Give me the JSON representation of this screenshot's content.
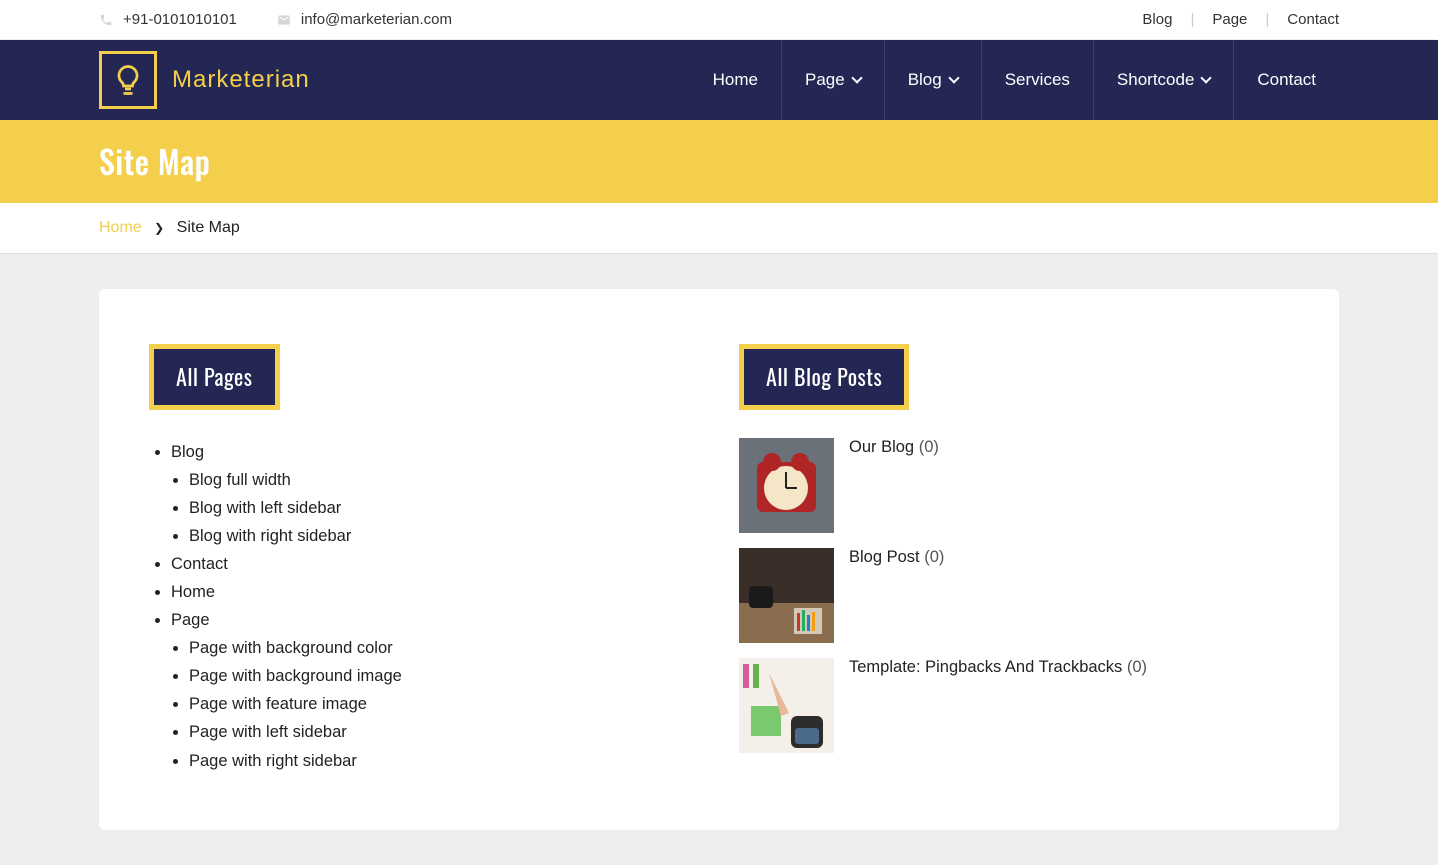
{
  "topbar": {
    "phone": "+91-0101010101",
    "email": "info@marketerian.com",
    "links": [
      "Blog",
      "Page",
      "Contact"
    ]
  },
  "brand": {
    "name": "Marketerian"
  },
  "nav": {
    "items": [
      {
        "label": "Home",
        "dropdown": false
      },
      {
        "label": "Page",
        "dropdown": true
      },
      {
        "label": "Blog",
        "dropdown": true
      },
      {
        "label": "Services",
        "dropdown": false
      },
      {
        "label": "Shortcode",
        "dropdown": true
      },
      {
        "label": "Contact",
        "dropdown": false
      }
    ]
  },
  "page_title": "Site Map",
  "breadcrumb": {
    "home": "Home",
    "current": "Site Map"
  },
  "sections": {
    "pages_title": "All Pages",
    "posts_title": "All Blog Posts"
  },
  "pages_tree": [
    {
      "label": "Blog",
      "children": [
        {
          "label": "Blog full width"
        },
        {
          "label": "Blog with left sidebar"
        },
        {
          "label": "Blog with right sidebar"
        }
      ]
    },
    {
      "label": "Contact"
    },
    {
      "label": "Home"
    },
    {
      "label": "Page",
      "children": [
        {
          "label": "Page with background color"
        },
        {
          "label": "Page with background image"
        },
        {
          "label": "Page with feature image"
        },
        {
          "label": "Page with left sidebar"
        },
        {
          "label": "Page with right sidebar"
        }
      ]
    }
  ],
  "posts": [
    {
      "title": "Our Blog",
      "count": "(0)",
      "thumb": "clock"
    },
    {
      "title": "Blog Post",
      "count": "(0)",
      "thumb": "desk"
    },
    {
      "title": "Template: Pingbacks And Trackbacks",
      "count": "(0)",
      "thumb": "notes"
    }
  ]
}
